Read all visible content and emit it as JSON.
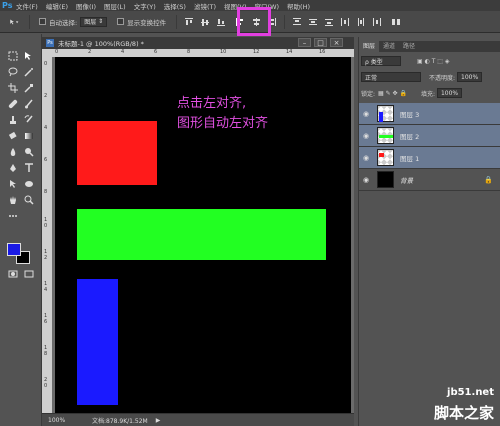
{
  "app": {
    "logo": "Ps"
  },
  "menu": [
    "文件(F)",
    "编辑(E)",
    "图像(I)",
    "图层(L)",
    "文字(Y)",
    "选择(S)",
    "滤镜(T)",
    "视图(V)",
    "窗口(W)",
    "帮助(H)"
  ],
  "options": {
    "auto_select_label": "自动选择:",
    "auto_select_value": "图层",
    "show_transform_label": "显示变换控件"
  },
  "colors": {
    "accent_highlight": "#e23fe0",
    "foreground": "#1919e6",
    "background": "#000000"
  },
  "document": {
    "title": "未标题-1 @ 100%(RGB/8) *",
    "ruler_top": [
      "0",
      "2",
      "4",
      "6",
      "8",
      "10",
      "12",
      "14",
      "16"
    ],
    "ruler_left": [
      "0",
      "2",
      "4",
      "6",
      "8",
      "1\n0",
      "1\n2",
      "1\n4",
      "1\n6",
      "1\n8",
      "2\n0"
    ],
    "annotation": "点击左对齐,\n图形自动左对齐",
    "zoom": "100%",
    "doc_size": "文档:878.9K/1.52M"
  },
  "panels": {
    "tabs": [
      "图层",
      "通道",
      "路径"
    ],
    "filter_label": "ρ 类型",
    "blend_mode": "正常",
    "opacity_label": "不透明度:",
    "opacity_value": "100%",
    "lock_label": "锁定:",
    "fill_label": "填充:",
    "fill_value": "100%",
    "layers": [
      {
        "name": "图层 3",
        "selected": true
      },
      {
        "name": "图层 2",
        "selected": true
      },
      {
        "name": "图层 1",
        "selected": true
      },
      {
        "name": "背景",
        "selected": false
      }
    ]
  },
  "watermark": {
    "url": "jb51.net",
    "text": "脚本之家"
  }
}
